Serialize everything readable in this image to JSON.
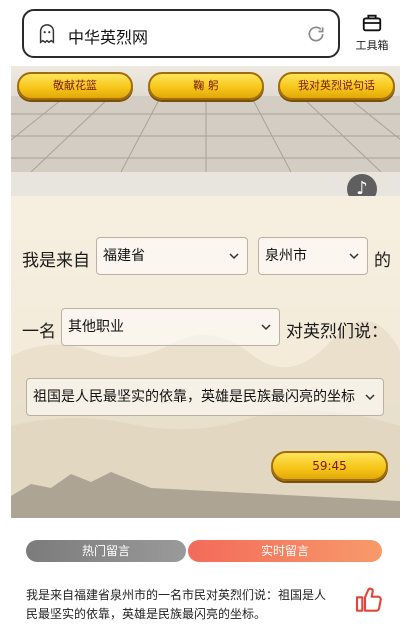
{
  "header": {
    "site_title": "中华英烈网",
    "toolbox_label": "工具箱",
    "icons": [
      "ghost-icon",
      "refresh-icon",
      "toolbox-icon"
    ]
  },
  "actions": {
    "flowers_label": "敬献花篮",
    "bow_label": "鞠 躬",
    "message_label": "我对英烈说句话"
  },
  "form": {
    "prefix": "我是来自",
    "province_value": "福建省",
    "city_value": "泉州市",
    "suffix_of": "的",
    "prefix_a": "一名",
    "job_value": "其他职业",
    "to_heroes": "对英烈们说：",
    "message_value": "祖国是人民最坚实的依靠，英雄是民族最闪亮的坐标",
    "submit_label": "59:45"
  },
  "tabs": {
    "hot_label": "热门留言",
    "live_label": "实时留言"
  },
  "comment": {
    "text": "我是来自福建省泉州市的一名市民对英烈们说：祖国是人民最坚实的依靠，英雄是民族最闪亮的坐标。"
  },
  "colors": {
    "gold_button": "#f5c416",
    "live_tab": "#f36a5a",
    "hot_tab": "#8a8a8a",
    "like_icon": "#e2463a"
  }
}
